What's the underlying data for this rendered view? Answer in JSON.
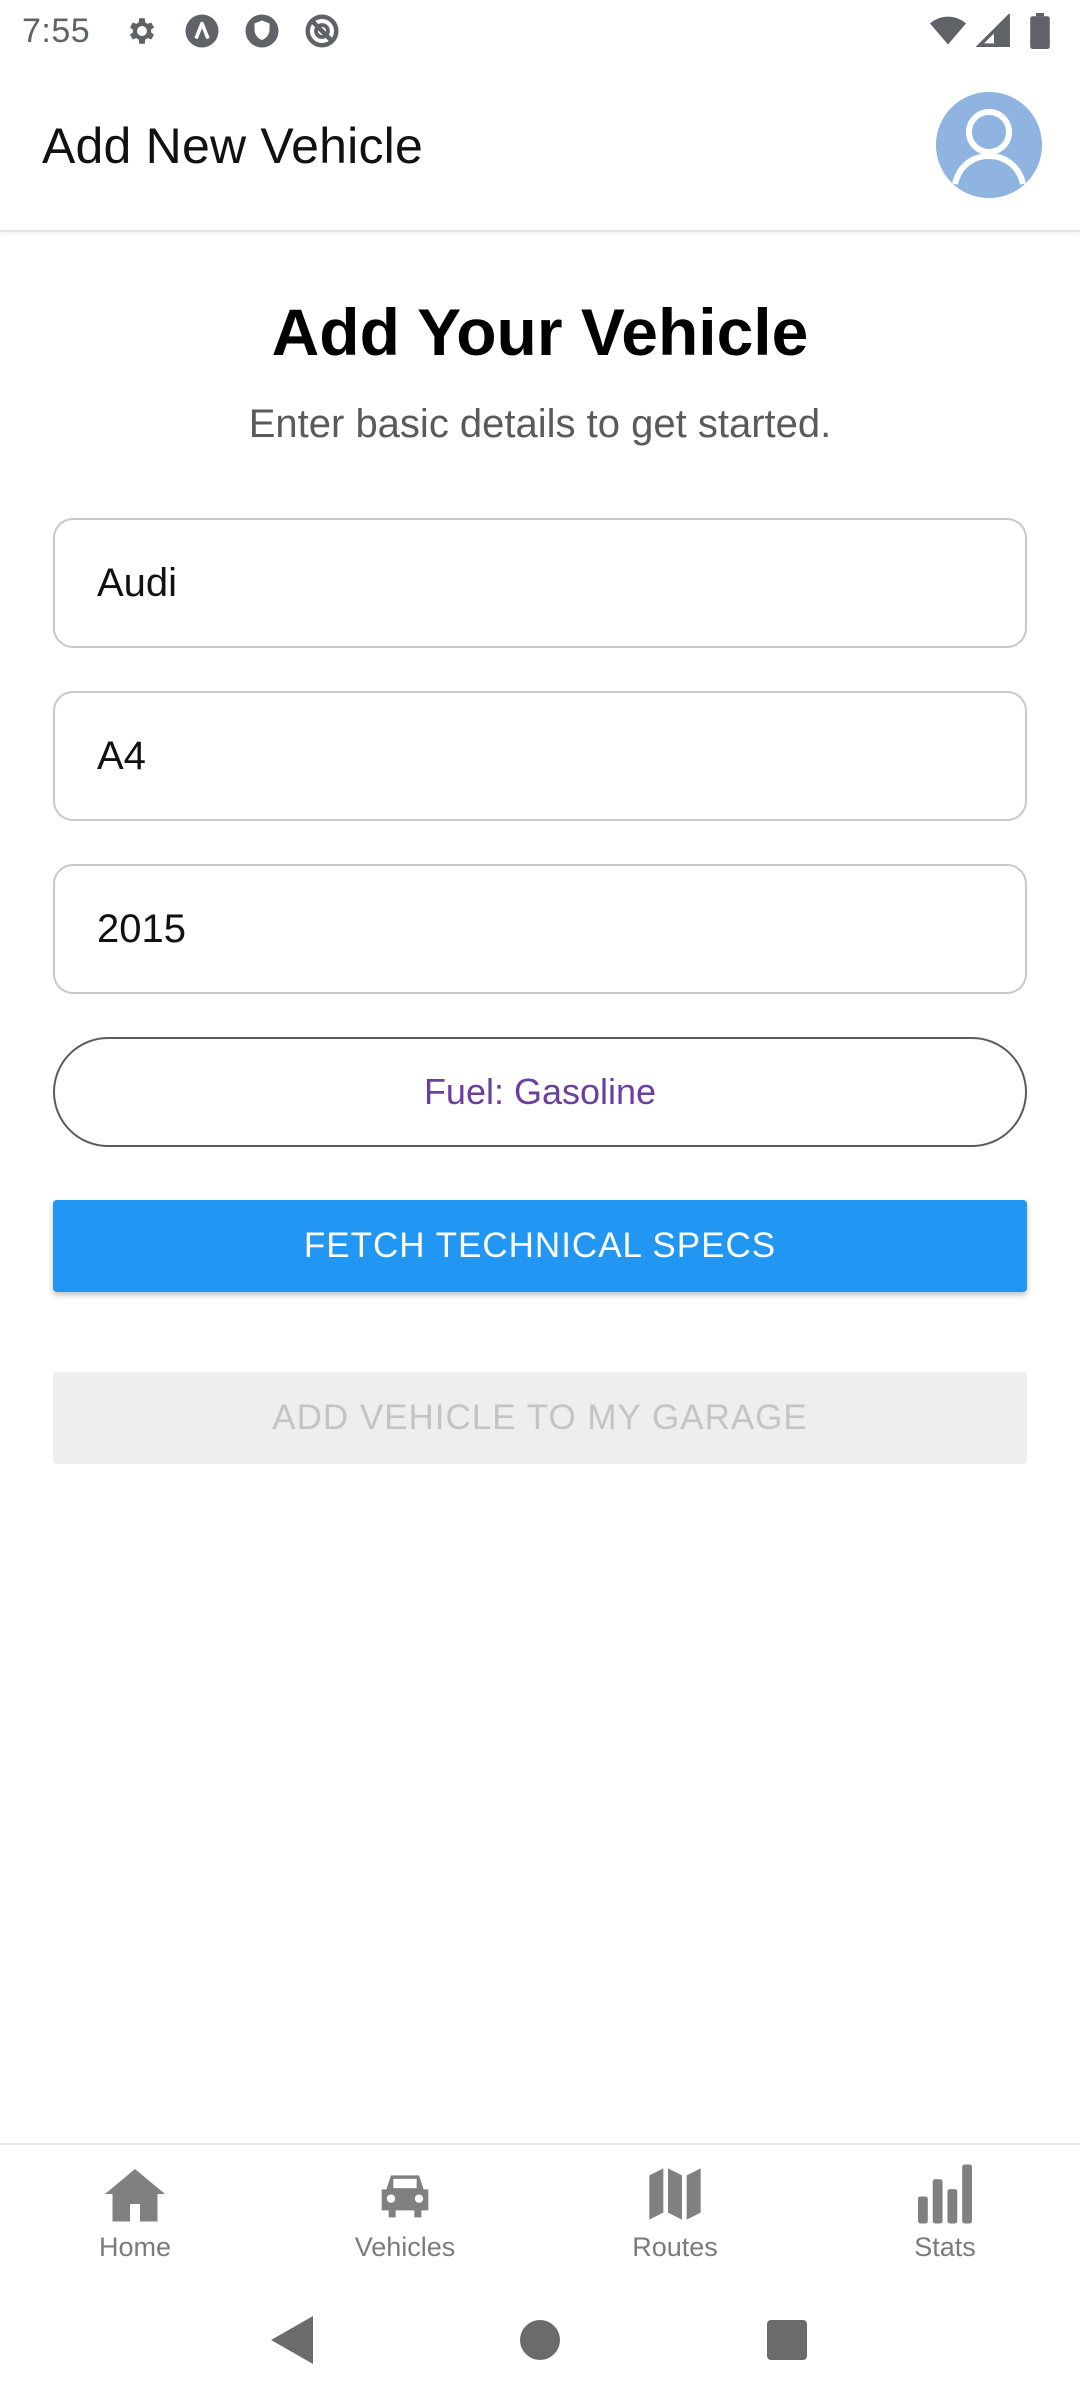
{
  "status_bar": {
    "time": "7:55",
    "left_icons": [
      "settings-icon",
      "a-icon",
      "shield-icon",
      "do-not-disturb-icon"
    ],
    "right_icons": [
      "wifi-icon",
      "signal-icon",
      "battery-icon"
    ]
  },
  "app_bar": {
    "title": "Add New Vehicle",
    "avatar_icon": "person-icon"
  },
  "form": {
    "title": "Add Your Vehicle",
    "subtitle": "Enter basic details to get started.",
    "make_value": "Audi",
    "model_value": "A4",
    "year_value": "2015",
    "fuel_label": "Fuel: Gasoline",
    "fetch_label": "FETCH TECHNICAL SPECS",
    "add_label": "ADD VEHICLE TO MY GARAGE"
  },
  "bottom_nav": {
    "items": [
      {
        "label": "Home",
        "icon": "home-icon"
      },
      {
        "label": "Vehicles",
        "icon": "car-icon"
      },
      {
        "label": "Routes",
        "icon": "map-icon"
      },
      {
        "label": "Stats",
        "icon": "bar-chart-icon"
      }
    ]
  },
  "colors": {
    "primary": "#2196f3",
    "fuel_text": "#6a3fa0",
    "disabled_bg": "#eeeeee",
    "disabled_text": "#c4c4c4",
    "avatar_bg": "#8fb4e0"
  }
}
